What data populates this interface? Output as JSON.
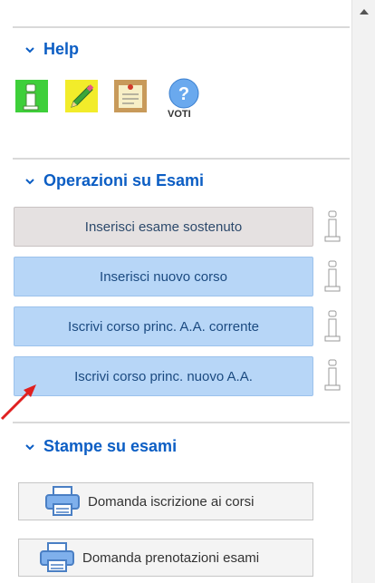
{
  "help": {
    "title": "Help",
    "voti_label": "VOTI"
  },
  "operazioni": {
    "title": "Operazioni su Esami",
    "buttons": [
      "Inserisci esame sostenuto",
      "Inserisci nuovo corso",
      "Iscrivi corso princ. A.A. corrente",
      "Iscrivi corso princ. nuovo A.A."
    ]
  },
  "stampe": {
    "title": "Stampe su esami",
    "buttons": [
      "Domanda iscrizione ai corsi",
      "Domanda prenotazioni esami"
    ]
  },
  "colors": {
    "accent": "#0c5ec4",
    "button_blue": "#b7d6f7",
    "button_gray": "#e5e1e1",
    "arrow_red": "#e02020"
  },
  "icons": [
    "info-icon",
    "pencil-icon",
    "note-icon",
    "question-icon",
    "printer-icon",
    "chevron-down-icon",
    "red-arrow-icon"
  ]
}
